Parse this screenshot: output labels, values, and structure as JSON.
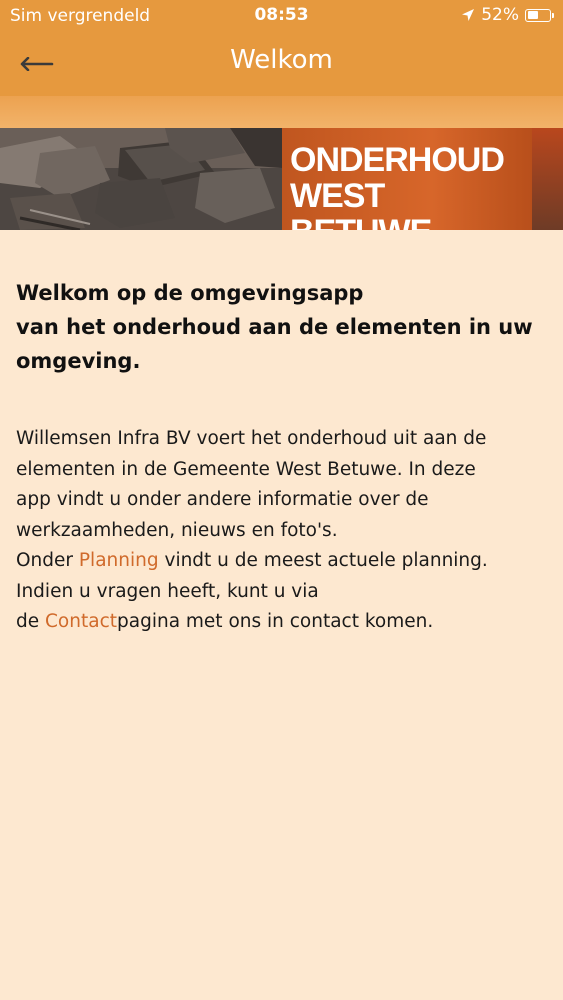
{
  "status_bar": {
    "carrier": "Sim vergrendeld",
    "time": "08:53",
    "battery_percent_text": "52%",
    "battery_level": 0.52,
    "location_icon": "location-arrow-icon"
  },
  "nav": {
    "title": "Welkom",
    "back_icon": "back-arrow-icon"
  },
  "banner": {
    "logo_line1": "ONDERHOUD",
    "logo_line2": "WEST BETUWE"
  },
  "content": {
    "heading_line1": "Welkom op de omgevingsapp",
    "heading_line2": "van het onderhoud aan de elementen in uw",
    "heading_line3": "omgeving.",
    "para_line1": "Willemsen Infra BV voert het onderhoud uit aan de",
    "para_line2": "elementen in de Gemeente West Betuwe. In deze",
    "para_line3": "app vindt u onder andere informatie over de",
    "para_line4": "werkzaamheden, nieuws en foto's.",
    "para_line5_prefix": "Onder ",
    "planning_link": "Planning",
    "para_line5_suffix": " vindt u de meest actuele planning.",
    "para_line6": "Indien u vragen heeft, kunt u via",
    "para_line7_prefix": "de ",
    "contact_link": "Contact",
    "para_line7_suffix": "pagina met ons in contact komen."
  },
  "colors": {
    "header": "#e6993e",
    "background": "#fde8d0",
    "link": "#d06a2b",
    "logo_box": "#d7662a"
  }
}
